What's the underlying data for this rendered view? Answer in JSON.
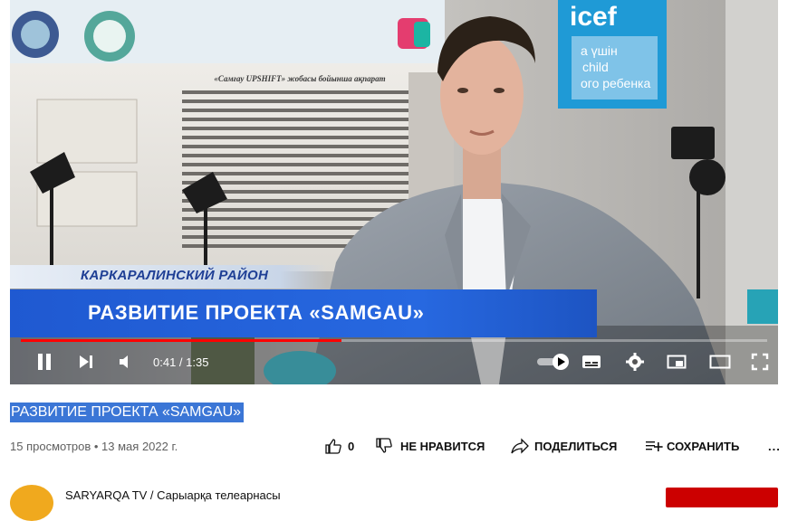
{
  "video": {
    "lower_third": {
      "district": "КАРКАРАЛИНСКИЙ РАЙОН",
      "headline": "РАЗВИТИЕ ПРОЕКТА «SAMGAU»"
    },
    "poster_text": {
      "heading": "«Самғау UPSHIFT» жобасы бойынша ақпарат",
      "unicef": "icef",
      "unicef_line1": "а үшін",
      "unicef_line2": "child",
      "unicef_line3": "ого ребенка"
    },
    "player": {
      "time": "0:41 / 1:35",
      "progress": 0.43
    }
  },
  "info": {
    "title": "РАЗВИТИЕ ПРОЕКТА «SAMGAU»",
    "views_date": "15 просмотров • 13 мая 2022 г.",
    "likes": "0",
    "dislike_label": "НЕ НРАВИТСЯ",
    "share_label": "ПОДЕЛИТЬСЯ",
    "save_label": "СОХРАНИТЬ",
    "more": "..."
  },
  "channel": {
    "name": "SARYARQA TV / Сарыарқа телеарнасы"
  },
  "colors": {
    "title_highlight": "#3b76d6",
    "progress": "#ff0000",
    "lower_third_blue": "#2563d6",
    "subscribe": "#cc0000"
  }
}
